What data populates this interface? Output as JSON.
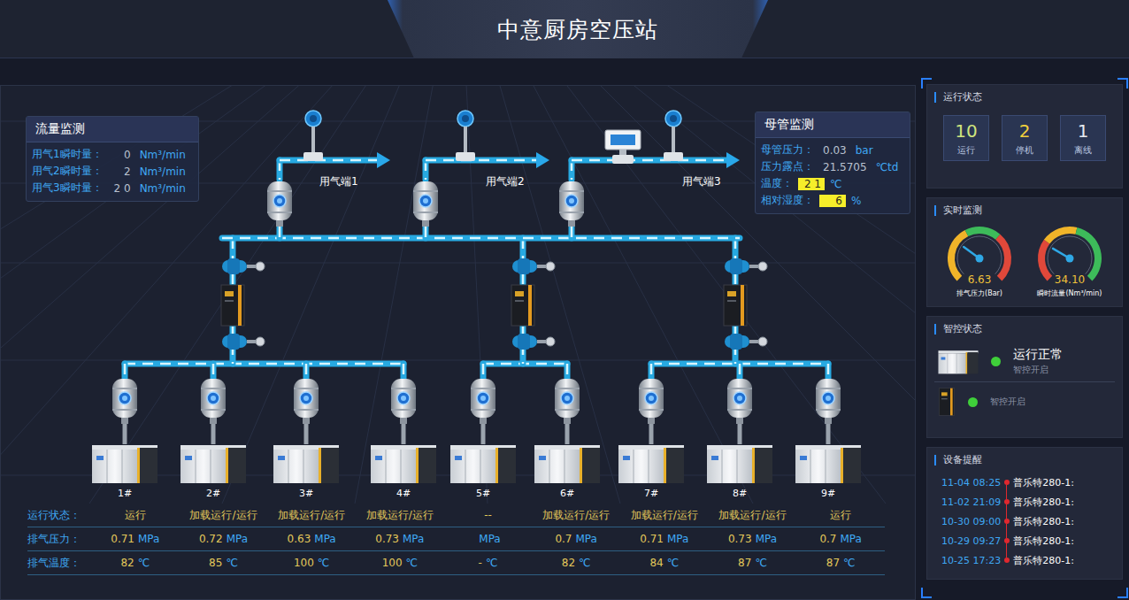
{
  "header": {
    "title": "中意厨房空压站"
  },
  "flow_panel": {
    "title": "流量监测",
    "rows": [
      {
        "label": "用气1瞬时量：",
        "value": "0",
        "unit": "Nm³/min"
      },
      {
        "label": "用气2瞬时量：",
        "value": "2",
        "unit": "Nm³/min"
      },
      {
        "label": "用气3瞬时量：",
        "value": "2 0",
        "unit": "Nm³/min"
      }
    ]
  },
  "main_pipe_panel": {
    "title": "母管监测",
    "rows": [
      {
        "label": "母管压力：",
        "value": "0.03",
        "unit": "bar",
        "highlighted": false
      },
      {
        "label": "压力露点：",
        "value": "21.5705",
        "unit": "℃td",
        "highlighted": false
      },
      {
        "label": "温度：",
        "value": "2  1",
        "unit": "℃",
        "highlighted": true
      },
      {
        "label": "相对湿度：",
        "value": "6",
        "unit": "%",
        "highlighted": true
      }
    ]
  },
  "outlets": [
    {
      "label": "用气端1"
    },
    {
      "label": "用气端2"
    },
    {
      "label": "用气端3"
    }
  ],
  "machines": [
    {
      "label": "1#",
      "status": "运行",
      "pressure": "0.71",
      "temperature": "82"
    },
    {
      "label": "2#",
      "status": "加载运行/运行",
      "pressure": "0.72",
      "temperature": "85"
    },
    {
      "label": "3#",
      "status": "加载运行/运行",
      "pressure": "0.63",
      "temperature": "100"
    },
    {
      "label": "4#",
      "status": "加载运行/运行",
      "pressure": "0.73",
      "temperature": "100"
    },
    {
      "label": "5#",
      "status": "--",
      "pressure": "",
      "temperature": "-"
    },
    {
      "label": "6#",
      "status": "加载运行/运行",
      "pressure": "0.7",
      "temperature": "82"
    },
    {
      "label": "7#",
      "status": "加载运行/运行",
      "pressure": "0.71",
      "temperature": "84"
    },
    {
      "label": "8#",
      "status": "加载运行/运行",
      "pressure": "0.73",
      "temperature": "87"
    },
    {
      "label": "9#",
      "status": "运行",
      "pressure": "0.7",
      "temperature": "87"
    }
  ],
  "table": {
    "status_label": "运行状态：",
    "pressure_label": "排气压力：",
    "temperature_label": "排气温度：",
    "pressure_unit": "MPa",
    "temperature_unit": "℃"
  },
  "run_status": {
    "title": "运行状态",
    "items": [
      {
        "count": "10",
        "label": "运行",
        "color": "#cfe47e"
      },
      {
        "count": "2",
        "label": "停机",
        "color": "#f1cf3c"
      },
      {
        "count": "1",
        "label": "离线",
        "color": "#e6e9ef"
      }
    ]
  },
  "realtime": {
    "title": "实时监测",
    "gauges": [
      {
        "value": "6.63",
        "label": "排气压力(Bar)",
        "level": 0.3
      },
      {
        "value": "34.10",
        "label": "瞬时流量(Nm³/min)",
        "level": 0.28
      }
    ]
  },
  "smart_control": {
    "title": "智控状态",
    "items": [
      {
        "kind": "compressor",
        "status": "运行正常",
        "mode": "智控开启",
        "on": true
      },
      {
        "kind": "dryer",
        "mode": "智控开启",
        "on": true
      }
    ]
  },
  "alerts": {
    "title": "设备提醒",
    "items": [
      {
        "time": "11-04 08:25",
        "device": "普乐特280-1:"
      },
      {
        "time": "11-02 21:09",
        "device": "普乐特280-1:"
      },
      {
        "time": "10-30 09:00",
        "device": "普乐特280-1:"
      },
      {
        "time": "10-29 09:27",
        "device": "普乐特280-1:"
      },
      {
        "time": "10-25 17:23",
        "device": "普乐特280-1:"
      }
    ]
  }
}
